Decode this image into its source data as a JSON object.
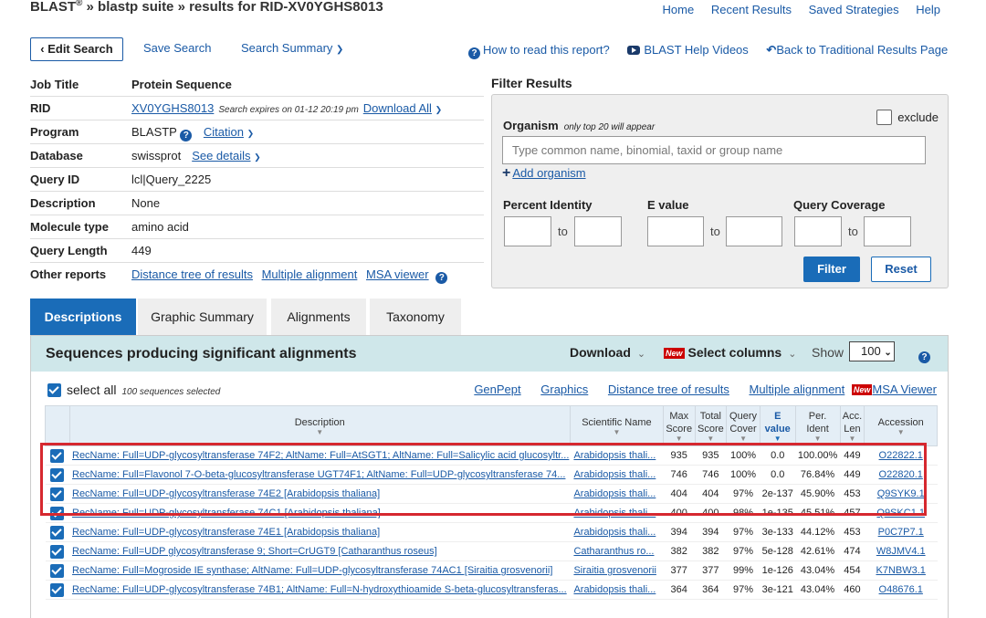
{
  "header": {
    "brand": "BLAST",
    "reg": "®",
    "crumb_rest": " » blastp suite » results for RID-XV0YGHS8013",
    "nav": [
      "Home",
      "Recent Results",
      "Saved Strategies",
      "Help"
    ]
  },
  "toolbar": {
    "edit_search": "‹ Edit Search",
    "save_search": "Save Search",
    "search_summary": "Search Summary",
    "how_to_read": "How to read this report?",
    "help_videos": "BLAST Help Videos",
    "back_traditional": "Back to Traditional Results Page"
  },
  "job": {
    "rows": [
      {
        "label": "Job Title",
        "value": "Protein Sequence"
      },
      {
        "label": "RID",
        "value": "XV0YGHS8013",
        "note": "Search expires on 01-12 20:19 pm",
        "extra": "Download All"
      },
      {
        "label": "Program",
        "value": "BLASTP",
        "extra": "Citation"
      },
      {
        "label": "Database",
        "value": "swissprot",
        "extra": "See details"
      },
      {
        "label": "Query ID",
        "value": "lcl|Query_2225"
      },
      {
        "label": "Description",
        "value": "None"
      },
      {
        "label": "Molecule type",
        "value": "amino acid"
      },
      {
        "label": "Query Length",
        "value": "449"
      },
      {
        "label": "Other reports",
        "links": [
          "Distance tree of results",
          "Multiple alignment",
          "MSA viewer"
        ]
      }
    ]
  },
  "filter": {
    "title": "Filter Results",
    "organism_label": "Organism",
    "organism_note": "only top 20 will appear",
    "exclude_label": "exclude",
    "organism_placeholder": "Type common  name, binomial, taxid or group  name",
    "add_organism": "Add organism",
    "percent_identity": "Percent Identity",
    "evalue": "E value",
    "query_coverage": "Query Coverage",
    "to": "to",
    "filter_btn": "Filter",
    "reset_btn": "Reset"
  },
  "tabs": [
    "Descriptions",
    "Graphic Summary",
    "Alignments",
    "Taxonomy"
  ],
  "results": {
    "title": "Sequences producing significant alignments",
    "download": "Download",
    "new_badge": "New",
    "select_columns": "Select columns",
    "show": "Show",
    "show_value": "100",
    "select_all": "select all",
    "selected_note": "100 sequences selected",
    "links": [
      "GenPept",
      "Graphics",
      "Distance tree of results",
      "Multiple alignment",
      "MSA Viewer"
    ],
    "columns": [
      "Description",
      "Scientific Name",
      "Max Score",
      "Total Score",
      "Query Cover",
      "E value",
      "Per. Ident",
      "Acc. Len",
      "Accession"
    ],
    "rows": [
      {
        "desc": "RecName: Full=UDP-glycosyltransferase 74F2; AltName: Full=AtSGT1; AltName: Full=Salicylic acid glucosyltr...",
        "sci": "Arabidopsis thali...",
        "max": "935",
        "total": "935",
        "cover": "100%",
        "e": "0.0",
        "ident": "100.00%",
        "len": "449",
        "acc": "O22822.1"
      },
      {
        "desc": "RecName: Full=Flavonol 7-O-beta-glucosyltransferase UGT74F1; AltName: Full=UDP-glycosyltransferase 74...",
        "sci": "Arabidopsis thali...",
        "max": "746",
        "total": "746",
        "cover": "100%",
        "e": "0.0",
        "ident": "76.84%",
        "len": "449",
        "acc": "O22820.1"
      },
      {
        "desc": "RecName: Full=UDP-glycosyltransferase 74E2 [Arabidopsis thaliana]",
        "sci": "Arabidopsis thali...",
        "max": "404",
        "total": "404",
        "cover": "97%",
        "e": "2e-137",
        "ident": "45.90%",
        "len": "453",
        "acc": "Q9SYK9.1"
      },
      {
        "desc": "RecName: Full=UDP-glycosyltransferase 74C1 [Arabidopsis thaliana]",
        "sci": "Arabidopsis thali...",
        "max": "400",
        "total": "400",
        "cover": "98%",
        "e": "1e-135",
        "ident": "45.51%",
        "len": "457",
        "acc": "Q9SKC1.1"
      },
      {
        "desc": "RecName: Full=UDP-glycosyltransferase 74E1 [Arabidopsis thaliana]",
        "sci": "Arabidopsis thali...",
        "max": "394",
        "total": "394",
        "cover": "97%",
        "e": "3e-133",
        "ident": "44.12%",
        "len": "453",
        "acc": "P0C7P7.1"
      },
      {
        "desc": "RecName: Full=UDP glycosyltransferase 9; Short=CrUGT9 [Catharanthus roseus]",
        "sci": "Catharanthus ro...",
        "max": "382",
        "total": "382",
        "cover": "97%",
        "e": "5e-128",
        "ident": "42.61%",
        "len": "474",
        "acc": "W8JMV4.1"
      },
      {
        "desc": "RecName: Full=Mogroside IE synthase; AltName: Full=UDP-glycosyltransferase 74AC1 [Siraitia grosvenorii]",
        "sci": "Siraitia grosvenorii",
        "max": "377",
        "total": "377",
        "cover": "99%",
        "e": "1e-126",
        "ident": "43.04%",
        "len": "454",
        "acc": "K7NBW3.1"
      },
      {
        "desc": "RecName: Full=UDP-glycosyltransferase 74B1; AltName: Full=N-hydroxythioamide S-beta-glucosyltransferas...",
        "sci": "Arabidopsis thali...",
        "max": "364",
        "total": "364",
        "cover": "97%",
        "e": "3e-121",
        "ident": "43.04%",
        "len": "460",
        "acc": "O48676.1"
      }
    ]
  },
  "colors": {
    "accent": "#1a6cb8",
    "link": "#1a5aa6",
    "highlight_box": "#d6282f",
    "section_bg": "#cfe7ea"
  }
}
